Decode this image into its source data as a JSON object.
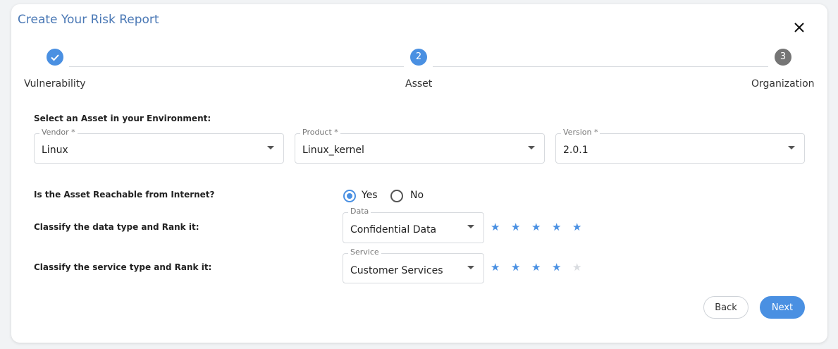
{
  "dialog": {
    "title": "Create Your Risk Report"
  },
  "stepper": {
    "steps": [
      {
        "label": "Vulnerability",
        "number": "1",
        "state": "completed"
      },
      {
        "label": "Asset",
        "number": "2",
        "state": "active"
      },
      {
        "label": "Organization",
        "number": "3",
        "state": "pending"
      }
    ],
    "colors": {
      "active": "#4a90e2",
      "pending": "#757575"
    }
  },
  "asset": {
    "heading": "Select an Asset in your Environment:",
    "vendor": {
      "label": "Vendor *",
      "value": "Linux"
    },
    "product": {
      "label": "Product *",
      "value": "Linux_kernel"
    },
    "version": {
      "label": "Version *",
      "value": "2.0.1"
    }
  },
  "reachable": {
    "question": "Is the Asset Reachable from Internet?",
    "options": [
      "Yes",
      "No"
    ],
    "selected": "Yes"
  },
  "data_classification": {
    "question": "Classify the data type and Rank it:",
    "label": "Data",
    "value": "Confidential Data",
    "rating": 5,
    "max_rating": 5
  },
  "service_classification": {
    "question": "Classify the service type and Rank it:",
    "label": "Service",
    "value": "Customer Services",
    "rating": 4,
    "max_rating": 5
  },
  "actions": {
    "back_label": "Back",
    "next_label": "Next"
  },
  "colors": {
    "accent": "#4a90e2",
    "star_on": "#4a90e2",
    "star_off": "#d9dce0",
    "title": "#4a78b5"
  }
}
